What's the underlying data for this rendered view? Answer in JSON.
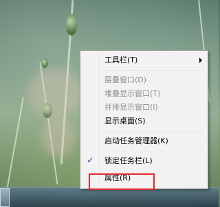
{
  "context_menu": {
    "items": [
      {
        "label": "工具栏(T)",
        "enabled": true,
        "has_submenu": true
      },
      {
        "label": "层叠窗口(D)",
        "enabled": false
      },
      {
        "label": "堆叠显示窗口(T)",
        "enabled": false
      },
      {
        "label": "并排显示窗口(I)",
        "enabled": false
      },
      {
        "label": "显示桌面(S)",
        "enabled": true
      },
      {
        "label": "启动任务管理器(K)",
        "enabled": true
      },
      {
        "label": "锁定任务栏(L)",
        "enabled": true,
        "checked": true
      },
      {
        "label": "属性(R)",
        "enabled": true,
        "highlighted": true
      }
    ],
    "check_mark": "✓",
    "highlight_color": "#e8272b"
  }
}
